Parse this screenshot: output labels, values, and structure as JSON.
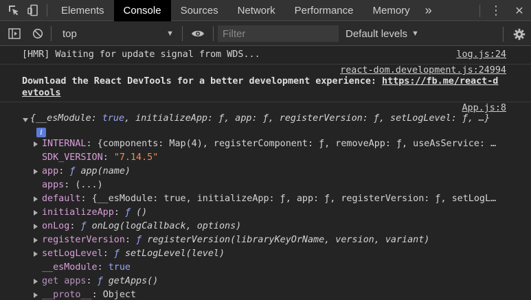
{
  "toolbar": {
    "tabs": [
      "Elements",
      "Console",
      "Sources",
      "Network",
      "Performance",
      "Memory"
    ],
    "active_tab": "Console",
    "more_tabs_glyph": "»",
    "kebab_glyph": "⋮",
    "close_glyph": "✕"
  },
  "filterbar": {
    "context": "top",
    "filter_placeholder": "Filter",
    "levels": "Default levels"
  },
  "messages": {
    "hmr": {
      "text": "[HMR] Waiting for update signal from WDS...",
      "source": "log.js:24"
    },
    "react": {
      "source": "react-dom.development.js:24994",
      "line1": "Download the React DevTools for a better development experience: ",
      "link1": "https://fb.me/react-d",
      "link2": "evtools"
    },
    "app": {
      "source": "App.js:8",
      "summary_open": "{",
      "summary_k1": "__esModule",
      "summary_v1": "true",
      "summary_rest1": ", initializeApp: ",
      "summary_f": "ƒ",
      "summary_rest2": ", app: ",
      "summary_rest3": ", registerVersion: ",
      "summary_rest4": ", setLogLevel: ",
      "summary_end": ", …}",
      "info": "i",
      "props": [
        {
          "key": "INTERNAL",
          "value": "{components: Map(4), registerComponent: ƒ, removeApp: ƒ, useAsService: …"
        },
        {
          "key": "SDK_VERSION",
          "value": "\"7.14.5\""
        },
        {
          "key": "app",
          "value": "app(name)"
        },
        {
          "key": "apps",
          "value": "(...)"
        },
        {
          "key": "default",
          "value": "{__esModule: true, initializeApp: ƒ, app: ƒ, registerVersion: ƒ, setLogL…"
        },
        {
          "key": "initializeApp",
          "value": "()"
        },
        {
          "key": "onLog",
          "value": "onLog(logCallback, options)"
        },
        {
          "key": "registerVersion",
          "value": "registerVersion(libraryKeyOrName, version, variant)"
        },
        {
          "key": "setLogLevel",
          "value": "setLogLevel(level)"
        },
        {
          "key": "__esModule",
          "value": "true"
        },
        {
          "key": "get apps",
          "value": "getApps()"
        },
        {
          "key": "__proto__",
          "value": "Object"
        }
      ]
    }
  },
  "icons": {
    "inspect": "inspect-element-icon",
    "device": "device-toolbar-icon",
    "sidebar": "sidebar-toggle-icon",
    "clear": "clear-console-icon",
    "eye": "live-expression-icon",
    "settings": "gear-icon"
  }
}
